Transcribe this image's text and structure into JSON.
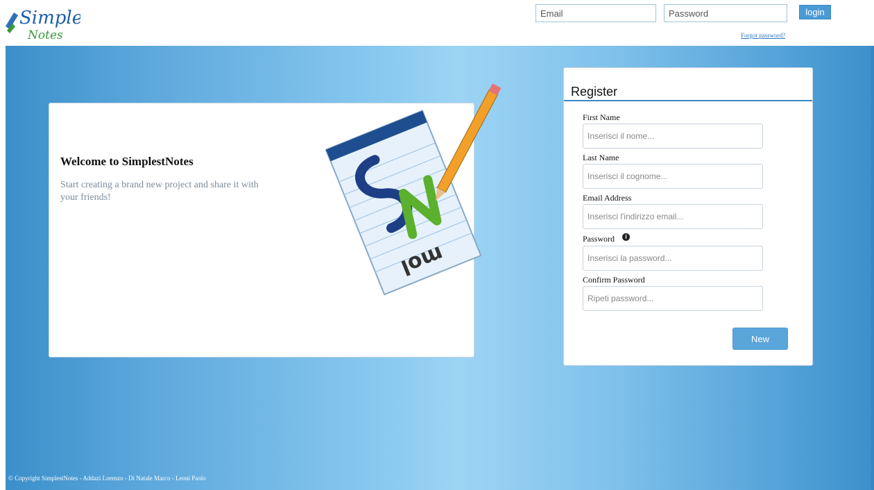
{
  "header": {
    "logo_text_top": "Simplest",
    "logo_text_bottom": "Notes",
    "email_placeholder": "Email",
    "password_placeholder": "Password",
    "login_label": "login",
    "forgot_label": "Forgot password?"
  },
  "welcome": {
    "title": "Welcome to SimplestNotes",
    "text": "Start creating a brand new project and share it with your friends!"
  },
  "register": {
    "title": "Register",
    "fields": [
      {
        "label": "First Name",
        "placeholder": "Inserisci il nome..."
      },
      {
        "label": "Last Name",
        "placeholder": "Inserisci il cognome..."
      },
      {
        "label": "Email Address",
        "placeholder": "Inserisci l'indirizzo email..."
      },
      {
        "label": "Password",
        "placeholder": "Inserisci la password..."
      },
      {
        "label": "Confirm Password",
        "placeholder": "Ripeti password..."
      }
    ],
    "submit_label": "New"
  },
  "footer": {
    "text": "© Copyright SimplestNotes - Addazi Lorenzo - Di Natale Marco - Leoni Paolo"
  },
  "colors": {
    "accent": "#4a9ad6",
    "hero_light": "#9dd4f4",
    "hero_dark": "#3b8fca"
  }
}
